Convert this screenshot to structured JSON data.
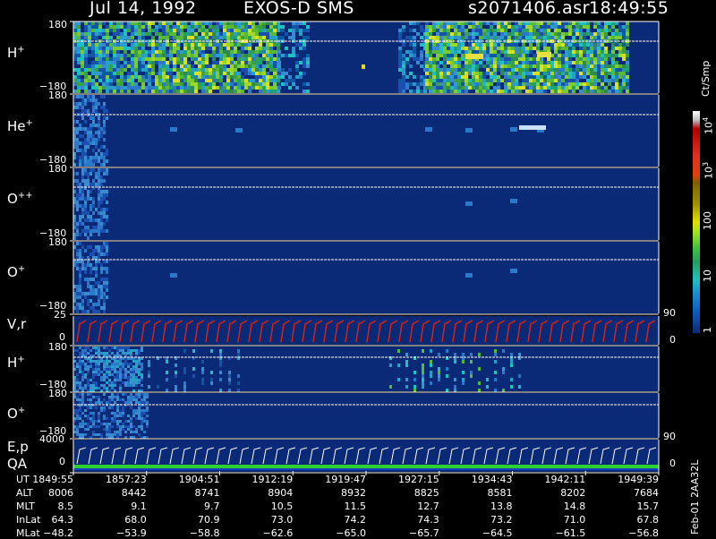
{
  "header": {
    "date": "Jul 14, 1992",
    "instrument": "EXOS-D SMS",
    "file": "s2071406.asr",
    "time": "18:49:55"
  },
  "colors": {
    "background": "#000000",
    "spectrogram_bg": "#0a2a78",
    "velocity_trace": "#d82010",
    "qa_line": "#30d030"
  },
  "panels": [
    {
      "id": "h-plus-1",
      "label_main": "H",
      "label_sup": "+",
      "ymax": "180",
      "ymin": "−180"
    },
    {
      "id": "he-plus",
      "label_main": "He",
      "label_sup": "+",
      "ymax": "180",
      "ymin": "−180"
    },
    {
      "id": "o-plus-plus",
      "label_main": "O",
      "label_sup": "++",
      "ymax": "180",
      "ymin": "−180"
    },
    {
      "id": "o-plus-1",
      "label_main": "O",
      "label_sup": "+",
      "ymax": "180",
      "ymin": "−180"
    },
    {
      "id": "vr",
      "label_main": "V,r",
      "label_sup": "",
      "ymax": "25",
      "ymin": "0",
      "right_top": "90",
      "right_bottom": "0"
    },
    {
      "id": "h-plus-2",
      "label_main": "H",
      "label_sup": "+",
      "ymax": "180",
      "ymin": "−180"
    },
    {
      "id": "o-plus-2",
      "label_main": "O",
      "label_sup": "+",
      "ymax": "180",
      "ymin": "−180",
      "right_bottom": "90"
    },
    {
      "id": "ep-qa",
      "label_main": "E,p",
      "label_sub": "QA",
      "ymax": "4000",
      "ymin": "0",
      "right_bottom": "0"
    }
  ],
  "colorbar": {
    "unit": "Ct/Smp",
    "ticks": [
      {
        "label": "10",
        "sup": "4"
      },
      {
        "label": "10",
        "sup": "3"
      },
      {
        "label": "100",
        "sup": ""
      },
      {
        "label": "10",
        "sup": ""
      },
      {
        "label": "1",
        "sup": ""
      }
    ]
  },
  "side_note": "Feb-01 2AA32L",
  "table": {
    "row_labels": [
      "UT",
      "ALT",
      "MLT",
      "InLat",
      "MLat"
    ],
    "columns": [
      [
        "1849:55",
        "8006",
        "8.5",
        "64.3",
        "−48.2"
      ],
      [
        "1857:23",
        "8442",
        "9.1",
        "68.0",
        "−53.9"
      ],
      [
        "1904:51",
        "8741",
        "9.7",
        "70.9",
        "−58.8"
      ],
      [
        "1912:19",
        "8904",
        "10.5",
        "73.0",
        "−62.6"
      ],
      [
        "1919:47",
        "8932",
        "11.5",
        "74.2",
        "−65.0"
      ],
      [
        "1927:15",
        "8825",
        "12.7",
        "74.3",
        "−65.7"
      ],
      [
        "1934:43",
        "8581",
        "13.8",
        "73.2",
        "−64.5"
      ],
      [
        "1942:11",
        "8202",
        "14.8",
        "71.0",
        "−61.5"
      ],
      [
        "1949:39",
        "7684",
        "15.7",
        "67.8",
        "−56.8"
      ]
    ]
  },
  "chart_data": {
    "type": "heatmap",
    "title": "Jul 14, 1992   EXOS-D SMS",
    "x_ticks": [
      "1849:55",
      "1857:23",
      "1904:51",
      "1912:19",
      "1919:47",
      "1927:15",
      "1934:43",
      "1942:11",
      "1949:39"
    ],
    "panels": [
      "H+",
      "He+",
      "O++",
      "O+",
      "V,r",
      "H+",
      "O+",
      "E,p QA"
    ],
    "y_range_pitch_deg": [
      -180,
      180
    ],
    "vr_range": [
      0,
      25
    ],
    "ep_range": [
      0,
      4000
    ],
    "colorbar_label": "Ct/Smp",
    "colorbar_ticks": [
      "1",
      "10",
      "100",
      "10^3",
      "10^4"
    ],
    "scale": "log"
  }
}
